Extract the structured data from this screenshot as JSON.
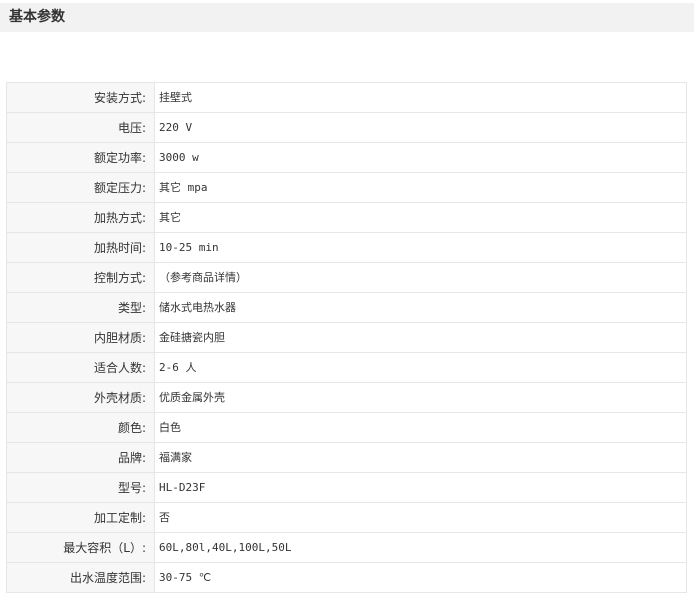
{
  "section": {
    "title": "基本参数"
  },
  "params": [
    {
      "label": "安装方式:",
      "value": "挂壁式"
    },
    {
      "label": "电压:",
      "value": "220 V"
    },
    {
      "label": "额定功率:",
      "value": "3000 w"
    },
    {
      "label": "额定压力:",
      "value": "其它 mpa"
    },
    {
      "label": "加热方式:",
      "value": "其它"
    },
    {
      "label": "加热时间:",
      "value": "10-25 min"
    },
    {
      "label": "控制方式:",
      "value": "（参考商品详情）"
    },
    {
      "label": "类型:",
      "value": "储水式电热水器"
    },
    {
      "label": "内胆材质:",
      "value": "金硅搪瓷内胆"
    },
    {
      "label": "适合人数:",
      "value": "2-6 人"
    },
    {
      "label": "外壳材质:",
      "value": "优质金属外壳"
    },
    {
      "label": "颜色:",
      "value": "白色"
    },
    {
      "label": "品牌:",
      "value": "福满家"
    },
    {
      "label": "型号:",
      "value": "HL-D23F"
    },
    {
      "label": "加工定制:",
      "value": "否"
    },
    {
      "label": "最大容积（L）:",
      "value": "60L,80l,40L,100L,50L"
    },
    {
      "label": "出水温度范围:",
      "value": "30-75 ℃"
    }
  ]
}
